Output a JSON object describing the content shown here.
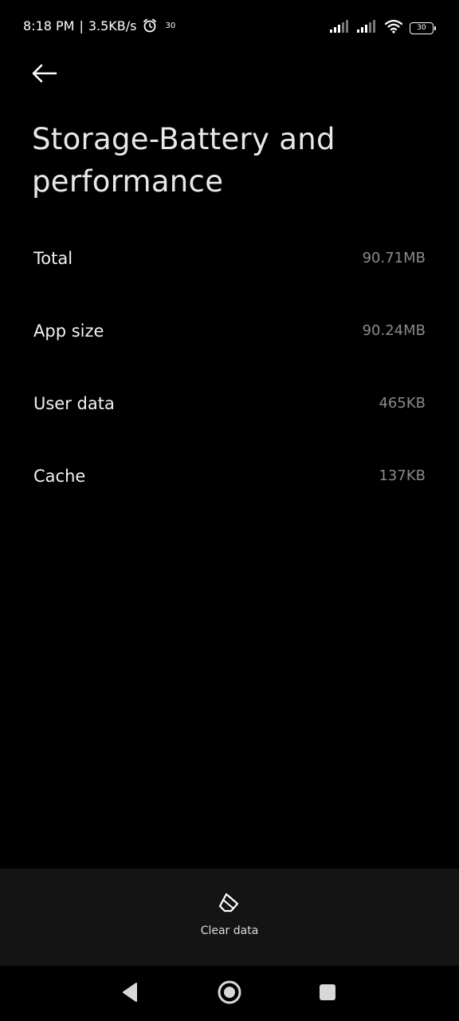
{
  "status_bar": {
    "time": "8:18 PM",
    "separator": "|",
    "network_speed": "3.5KB/s",
    "notification_count": "30",
    "battery_level": "30",
    "icons": [
      "alarm-icon",
      "signal-icon",
      "signal-icon",
      "wifi-icon",
      "battery-icon"
    ]
  },
  "header": {
    "back_icon": "arrow-left-icon",
    "title": "Storage-Battery and performance"
  },
  "storage": {
    "rows": [
      {
        "label": "Total",
        "value": "90.71MB"
      },
      {
        "label": "App size",
        "value": "90.24MB"
      },
      {
        "label": "User data",
        "value": "465KB"
      },
      {
        "label": "Cache",
        "value": "137KB"
      }
    ]
  },
  "actions": {
    "clear_data_icon": "eraser-icon",
    "clear_data_label": "Clear data"
  },
  "nav_bar": {
    "icons": [
      "back-triangle-icon",
      "home-circle-icon",
      "recents-square-icon"
    ]
  },
  "colors": {
    "background": "#000000",
    "action_bar": "#141414",
    "value_text": "#8a8a8a"
  }
}
